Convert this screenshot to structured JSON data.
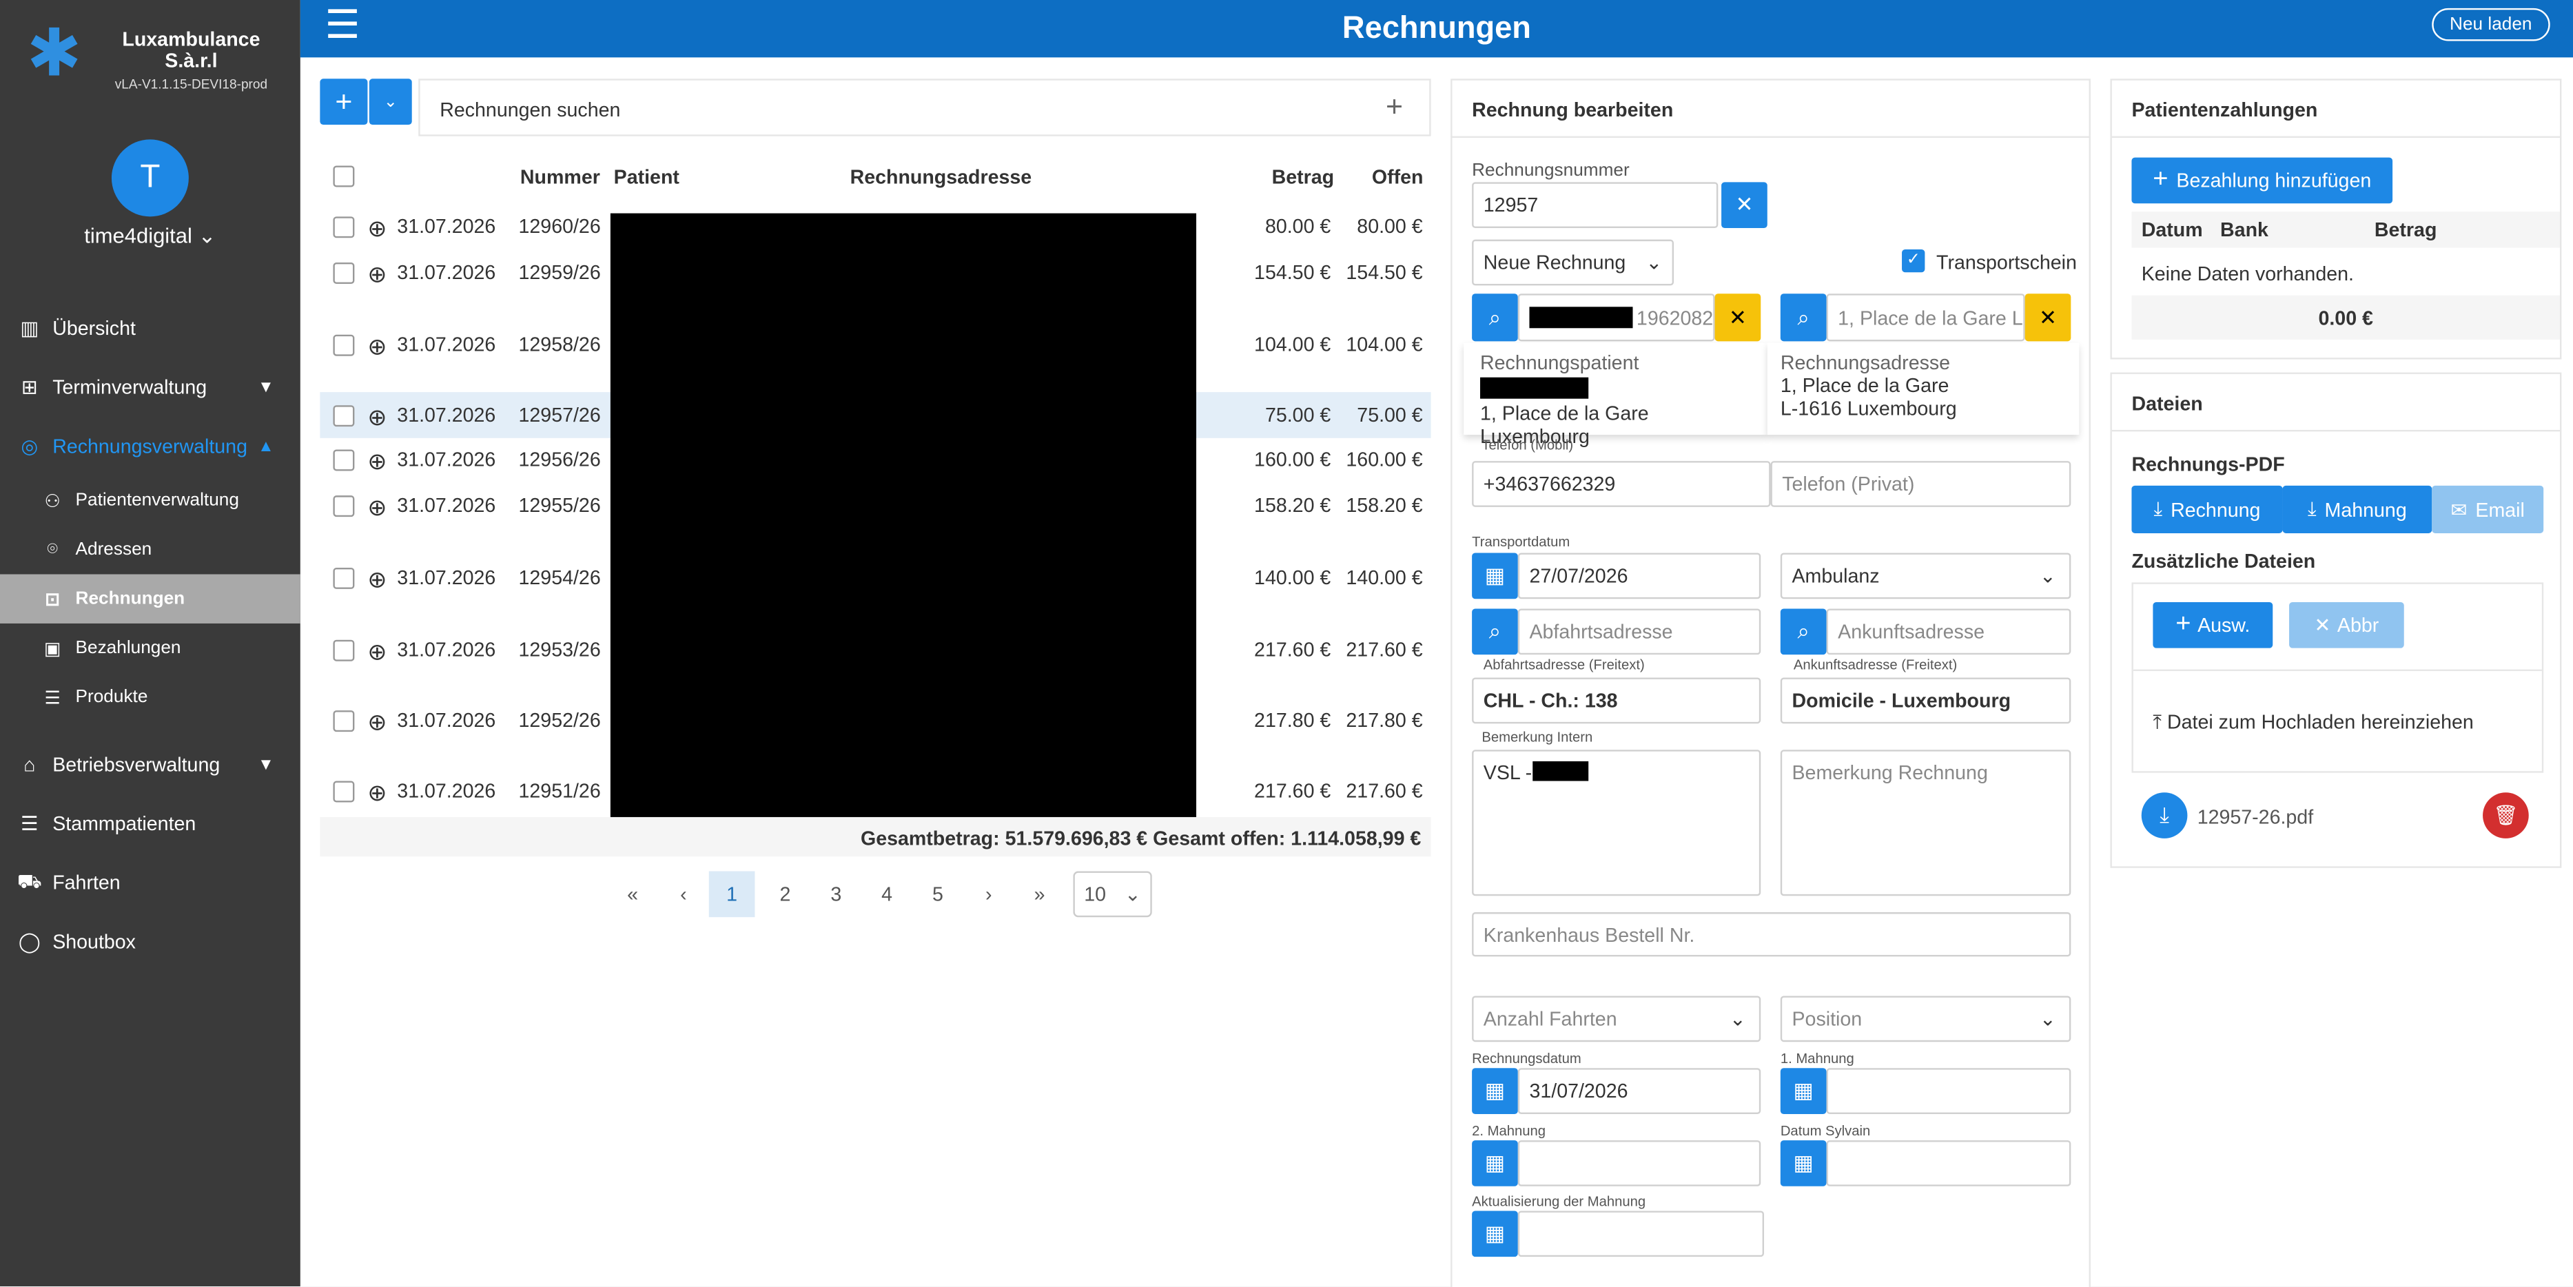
{
  "brand": {
    "name": "Luxambulance S.à.r.l",
    "version": "vLA-V1.1.15-DEVI18-prod"
  },
  "user": {
    "initial": "T",
    "name": "time4digital"
  },
  "nav": {
    "overview": "Übersicht",
    "appointments": "Terminverwaltung",
    "billing": "Rechnungsverwaltung",
    "patients": "Patientenverwaltung",
    "addresses": "Adressen",
    "invoices": "Rechnungen",
    "payments": "Bezahlungen",
    "products": "Produkte",
    "operations": "Betriebsverwaltung",
    "regular": "Stammpatienten",
    "trips": "Fahrten",
    "shoutbox": "Shoutbox"
  },
  "header": {
    "title": "Rechnungen",
    "reload": "Neu laden"
  },
  "list": {
    "search_label": "Rechnungen suchen",
    "cols": {
      "number": "Nummer",
      "patient": "Patient",
      "address": "Rechnungsadresse",
      "amount": "Betrag",
      "open": "Offen"
    },
    "rows": [
      {
        "date": "31.07.2026",
        "num": "12960/26",
        "amount": "80.00 €",
        "open": "80.00 €"
      },
      {
        "date": "31.07.2026",
        "num": "12959/26",
        "amount": "154.50 €",
        "open": "154.50 €"
      },
      {
        "date": "31.07.2026",
        "num": "12958/26",
        "amount": "104.00 €",
        "open": "104.00 €"
      },
      {
        "date": "31.07.2026",
        "num": "12957/26",
        "amount": "75.00 €",
        "open": "75.00 €"
      },
      {
        "date": "31.07.2026",
        "num": "12956/26",
        "amount": "160.00 €",
        "open": "160.00 €"
      },
      {
        "date": "31.07.2026",
        "num": "12955/26",
        "amount": "158.20 €",
        "open": "158.20 €"
      },
      {
        "date": "31.07.2026",
        "num": "12954/26",
        "amount": "140.00 €",
        "open": "140.00 €"
      },
      {
        "date": "31.07.2026",
        "num": "12953/26",
        "amount": "217.60 €",
        "open": "217.60 €"
      },
      {
        "date": "31.07.2026",
        "num": "12952/26",
        "amount": "217.80 €",
        "open": "217.80 €"
      },
      {
        "date": "31.07.2026",
        "num": "12951/26",
        "amount": "217.60 €",
        "open": "217.60 €"
      }
    ],
    "totals": "Gesamtbetrag: 51.579.696,83 €  Gesamt offen: 1.114.058,99 €",
    "pages": [
      "1",
      "2",
      "3",
      "4",
      "5"
    ],
    "page_size": "10"
  },
  "edit": {
    "title": "Rechnung bearbeiten",
    "invoice_number_label": "Rechnungsnummer",
    "invoice_number": "12957",
    "type": "Neue Rechnung",
    "transport_label": "Transportschein",
    "patient_search_suffix": "1962082",
    "address_search": "1, Place de la Gare  L",
    "billing_patient_label": "Rechnungspatient",
    "billing_patient_addr": "1, Place de la Gare Luxembourg",
    "billing_address_label": "Rechnungsadresse",
    "billing_address_1": "1, Place de la Gare",
    "billing_address_2": "L-1616 Luxembourg",
    "phone_mobile_label": "Telefon (Mobil)",
    "phone_mobile": "+34637662329",
    "phone_private_ph": "Telefon (Privat)",
    "transport_date_label": "Transportdatum",
    "transport_date": "27/07/2026",
    "vehicle": "Ambulanz",
    "departure_ph": "Abfahrtsadresse",
    "arrival_ph": "Ankunftsadresse",
    "departure_free_label": "Abfahrtsadresse (Freitext)",
    "departure_free": "CHL - Ch.: 138",
    "arrival_free_label": "Ankunftsadresse (Freitext)",
    "arrival_free": "Domicile - Luxembourg",
    "remark_internal_label": "Bemerkung Intern",
    "remark_internal": "VSL - ",
    "remark_invoice_ph": "Bemerkung Rechnung",
    "hospital_order_ph": "Krankenhaus Bestell Nr.",
    "trips_count_ph": "Anzahl Fahrten",
    "position_ph": "Position",
    "invoice_date_label": "Rechnungsdatum",
    "invoice_date": "31/07/2026",
    "reminder1_label": "1. Mahnung",
    "reminder2_label": "2. Mahnung",
    "sylvain_label": "Datum Sylvain",
    "reminder_update_label": "Aktualisierung der Mahnung"
  },
  "payments": {
    "title": "Patientenzahlungen",
    "add": "Bezahlung hinzufügen",
    "cols": {
      "date": "Datum",
      "bank": "Bank",
      "amount": "Betrag"
    },
    "empty": "Keine Daten vorhanden.",
    "total": "0.00 €"
  },
  "files": {
    "title": "Dateien",
    "pdf_label": "Rechnungs-PDF",
    "invoice_btn": "Rechnung",
    "reminder_btn": "Mahnung",
    "email_btn": "Email",
    "extra_label": "Zusätzliche Dateien",
    "choose": "Ausw.",
    "cancel": "Abbr",
    "drop": "Datei zum Hochladen hereinziehen",
    "file": "12957-26.pdf"
  }
}
